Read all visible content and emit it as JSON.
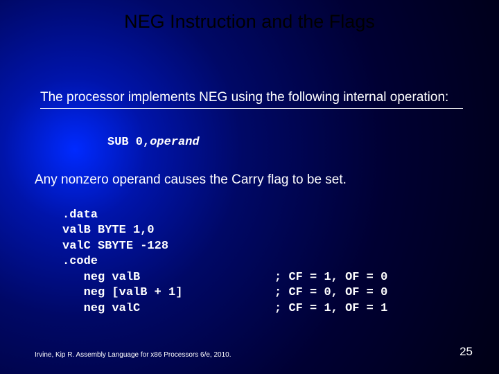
{
  "title": "NEG Instruction and the Flags",
  "para1": "The processor implements  NEG using the following internal operation:",
  "sub_prefix": "SUB 0,",
  "sub_operand": "operand",
  "para2": "Any nonzero operand causes the Carry flag to be set.",
  "code": ".data\nvalB BYTE 1,0\nvalC SBYTE -128\n.code\n   neg valB                   ; CF = 1, OF = 0\n   neg [valB + 1]             ; CF = 0, OF = 0\n   neg valC                   ; CF = 1, OF = 1",
  "footer": "Irvine, Kip R. Assembly Language for x86 Processors 6/e, 2010.",
  "pagenum": "25"
}
